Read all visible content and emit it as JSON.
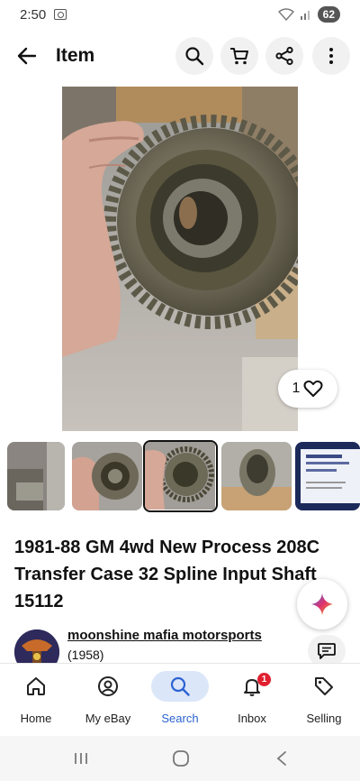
{
  "status_bar": {
    "time": "2:50",
    "battery": "62"
  },
  "header": {
    "title": "Item"
  },
  "icons": {
    "back": "arrow-left-icon",
    "search": "search-icon",
    "cart": "cart-icon",
    "share": "share-icon",
    "more": "more-vertical-icon",
    "heart": "heart-icon",
    "ai": "sparkle-icon",
    "message": "message-icon"
  },
  "gallery": {
    "like_count": "1",
    "thumbnail_count": 5,
    "selected_index": 2
  },
  "item": {
    "title": "1981-88 GM 4wd New Process 208C Transfer Case 32 Spline Input Shaft 15112"
  },
  "seller": {
    "name": "moonshine mafia motorsports",
    "feedback": "(1958)"
  },
  "bottom_nav": {
    "items": [
      {
        "label": "Home",
        "icon": "home-icon"
      },
      {
        "label": "My eBay",
        "icon": "account-icon"
      },
      {
        "label": "Search",
        "icon": "search-icon",
        "active": true
      },
      {
        "label": "Inbox",
        "icon": "bell-icon",
        "badge": "1"
      },
      {
        "label": "Selling",
        "icon": "tag-icon"
      }
    ]
  },
  "colors": {
    "accent": "#2b63d1",
    "badge": "#e0202f",
    "active_bg": "#dbe6f9"
  }
}
